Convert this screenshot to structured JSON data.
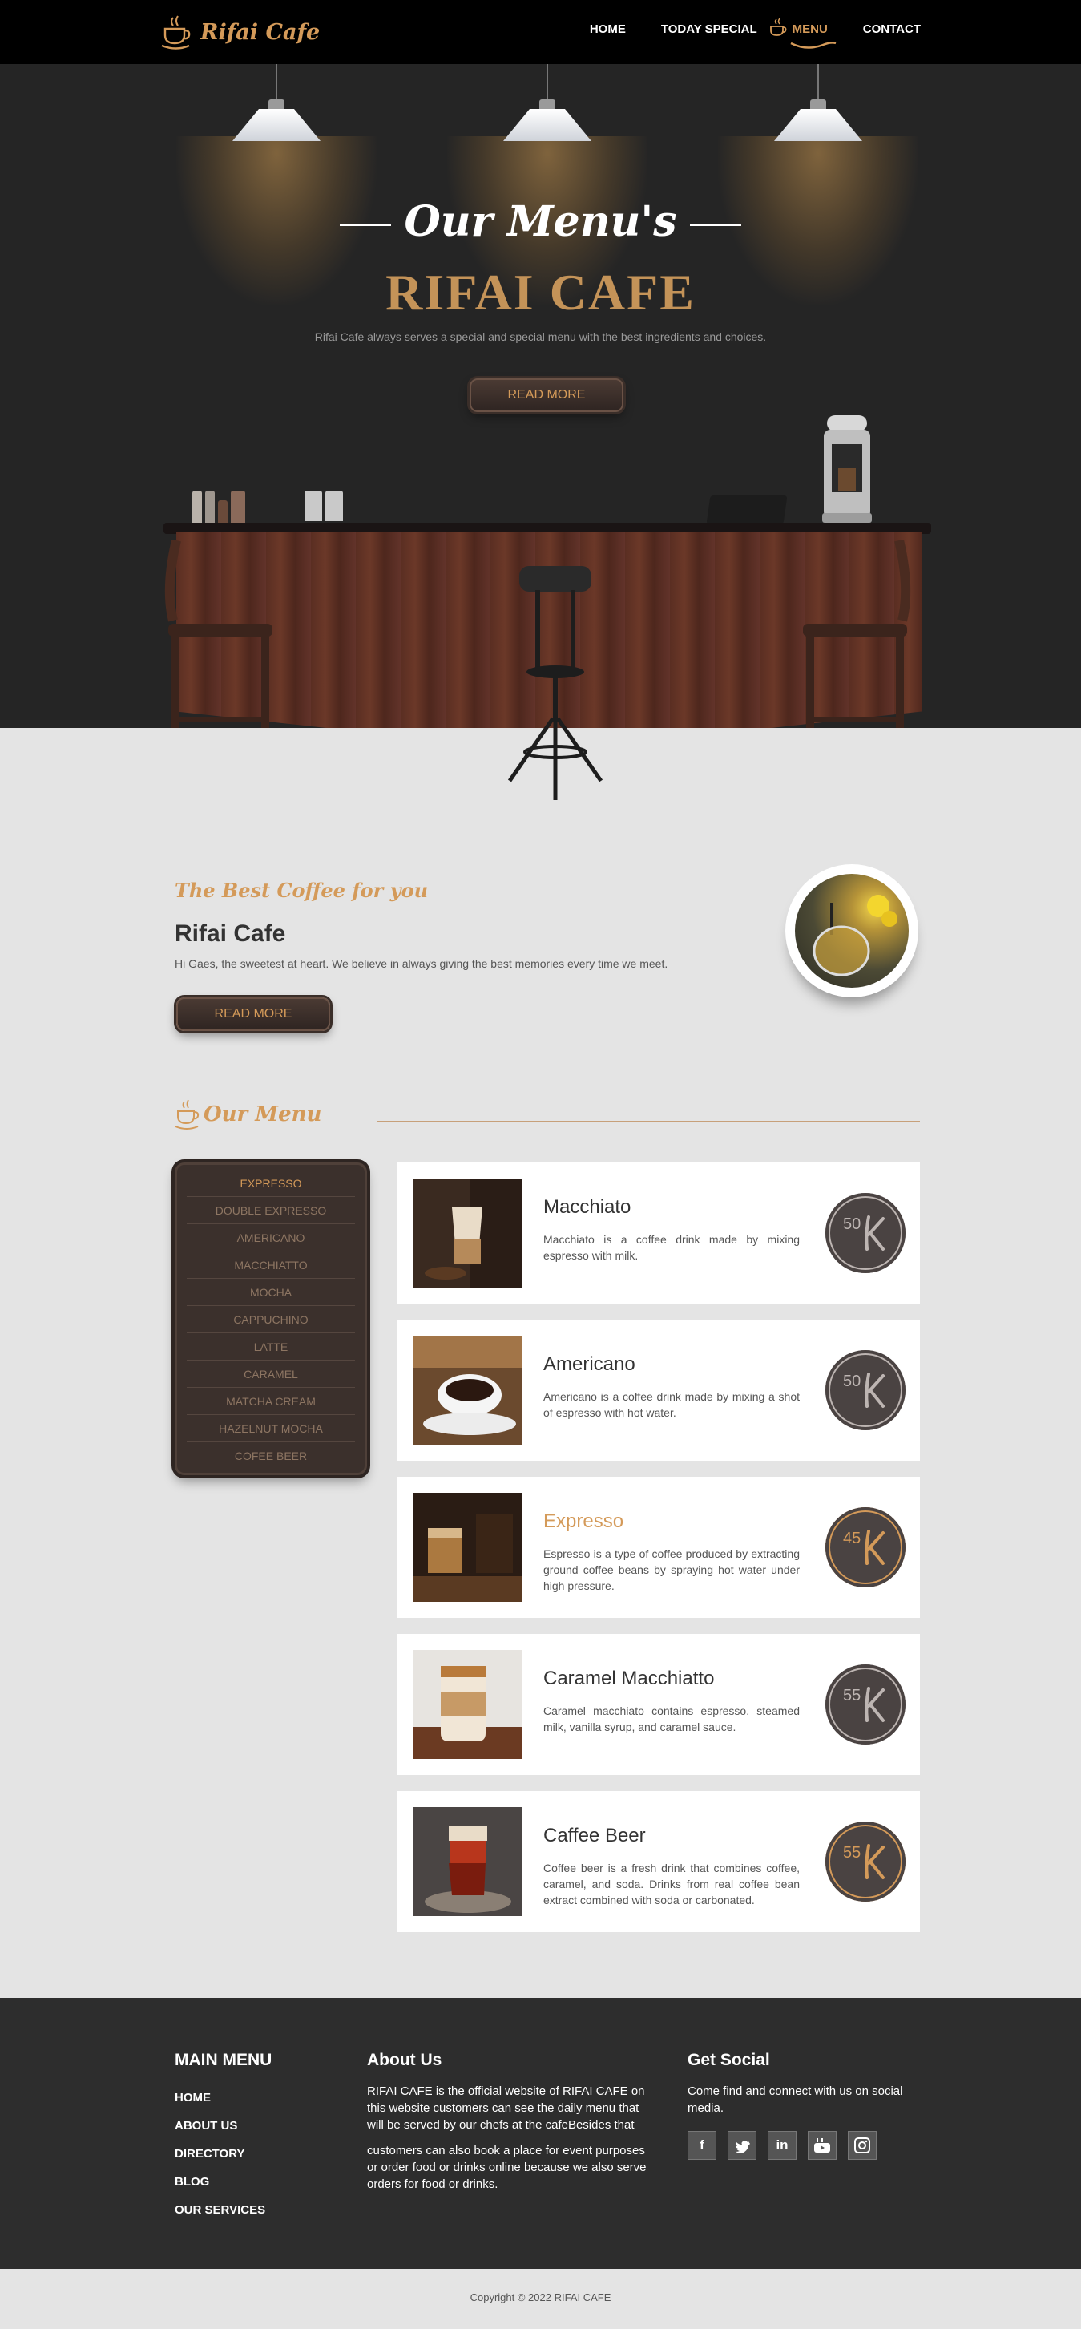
{
  "brand": {
    "name": "Rifai Cafe",
    "icon": "coffee-cup-icon",
    "accent_color": "#d49a59"
  },
  "nav": {
    "items": [
      {
        "label": "HOME",
        "active": false
      },
      {
        "label": "TODAY SPECIAL",
        "active": false
      },
      {
        "label": "MENU",
        "active": true
      },
      {
        "label": "CONTACT",
        "active": false
      }
    ]
  },
  "hero": {
    "script_title": "Our Menu's",
    "title": "RIFAI CAFE",
    "subtitle": "Rifai Cafe always serves a special and special menu with the best ingredients and choices.",
    "button": "READ MORE"
  },
  "about": {
    "script_title": "The Best Coffee for you",
    "title": "Rifai Cafe",
    "text": "Hi Gaes, the sweetest at heart. We believe in always giving the best memories every time we meet.",
    "button": "READ MORE"
  },
  "menu_section": {
    "heading": "Our Menu",
    "categories": [
      {
        "label": "EXPRESSO",
        "active": true
      },
      {
        "label": "DOUBLE EXPRESSO",
        "active": false
      },
      {
        "label": "AMERICANO",
        "active": false
      },
      {
        "label": "MACCHIATTO",
        "active": false
      },
      {
        "label": "MOCHA",
        "active": false
      },
      {
        "label": "CAPPUCHINO",
        "active": false
      },
      {
        "label": "LATTE",
        "active": false
      },
      {
        "label": "CARAMEL",
        "active": false
      },
      {
        "label": "MATCHA CREAM",
        "active": false
      },
      {
        "label": "HAZELNUT MOCHA",
        "active": false
      },
      {
        "label": "COFEE BEER",
        "active": false
      }
    ],
    "items": [
      {
        "name": "Macchiato",
        "desc": "Macchiato is a coffee drink made by mixing espresso with milk.",
        "price": "50",
        "highlight": false
      },
      {
        "name": "Americano",
        "desc": "Americano is a coffee drink made by mixing a shot of espresso with hot water.",
        "price": "50",
        "highlight": false
      },
      {
        "name": "Expresso",
        "desc": "Espresso is a type of coffee produced by extracting ground coffee beans by spraying hot water under high pressure.",
        "price": "45",
        "highlight": true
      },
      {
        "name": "Caramel Macchiatto",
        "desc": "Caramel macchiato contains espresso, steamed milk, vanilla syrup, and caramel sauce.",
        "price": "55",
        "highlight": false
      },
      {
        "name": "Caffee Beer",
        "desc": "Coffee beer is a fresh drink that combines coffee, caramel, and soda. Drinks from real coffee bean extract combined with soda or carbonated.",
        "price": "55",
        "highlight": true
      }
    ]
  },
  "footer": {
    "main_menu_title": "MAIN MENU",
    "main_menu": [
      "HOME",
      "ABOUT US",
      "DIRECTORY",
      "BLOG",
      "OUR SERVICES"
    ],
    "about_title": "About Us",
    "about_p1": "RIFAI CAFE is the official website of RIFAI CAFE on this website customers can see the daily menu that will be served by our chefs at the cafeBesides that",
    "about_p2": "customers can also book a place for event purposes or order food or drinks online because we also serve orders for food or drinks.",
    "social_title": "Get Social",
    "social_text": "Come find and connect with us on social media.",
    "social_icons": [
      {
        "icon": "facebook-icon",
        "glyph": "f"
      },
      {
        "icon": "twitter-icon",
        "glyph": "🐦"
      },
      {
        "icon": "linkedin-icon",
        "glyph": "in"
      },
      {
        "icon": "youtube-icon",
        "glyph": "▶"
      },
      {
        "icon": "instagram-icon",
        "glyph": "◎"
      }
    ]
  },
  "copyright": "Copyright © 2022 RIFAI CAFE"
}
